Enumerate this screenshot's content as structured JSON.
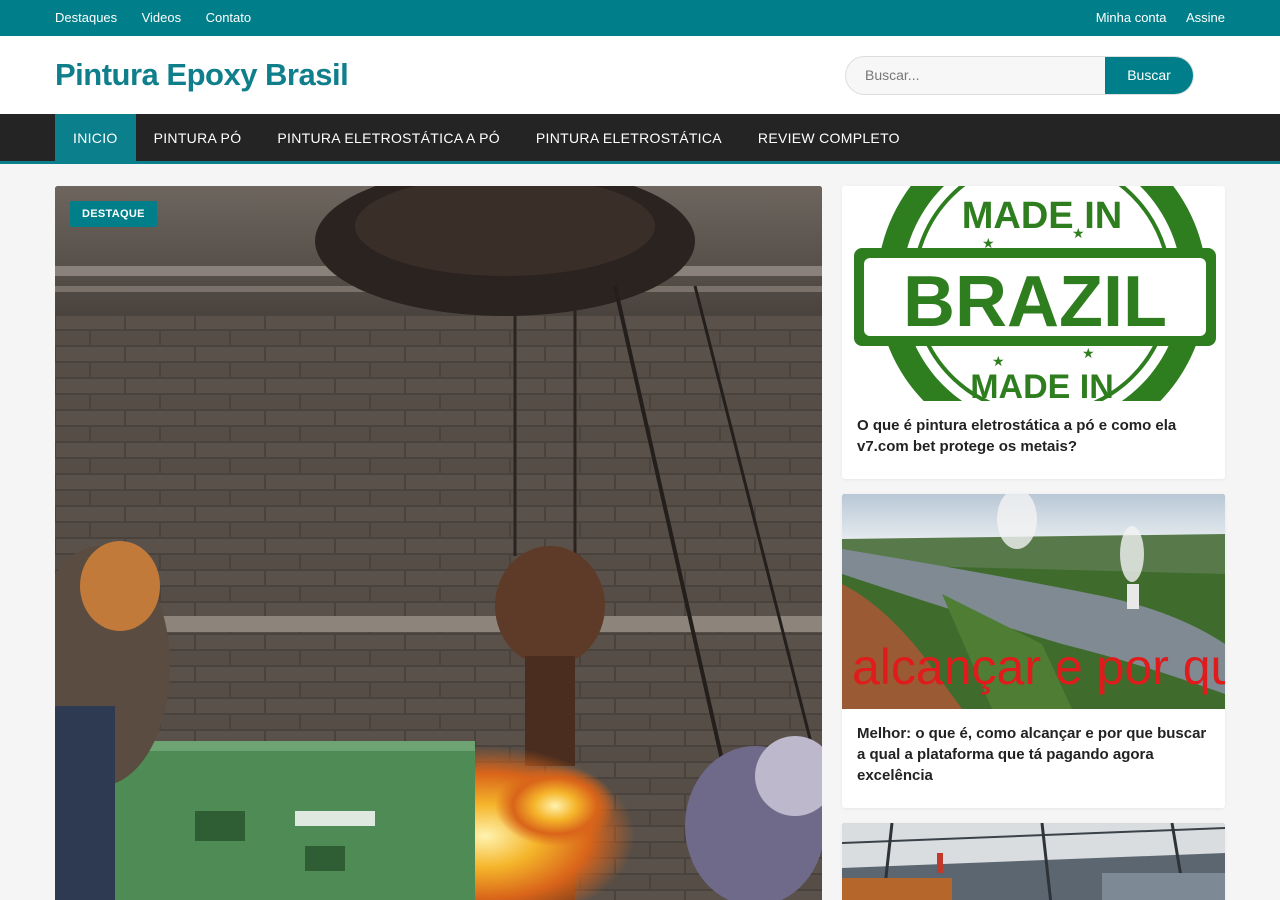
{
  "topbar": {
    "left_links": [
      "Destaques",
      "Videos",
      "Contato"
    ],
    "right_links": [
      "Minha conta",
      "Assine"
    ]
  },
  "header": {
    "logo": "Pintura Epoxy Brasil",
    "search_placeholder": "Buscar...",
    "search_button": "Buscar"
  },
  "nav": {
    "items": [
      "INICIO",
      "PINTURA PÓ",
      "PINTURA ELETROSTÁTICA A PÓ",
      "PINTURA ELETROSTÁTICA",
      "REVIEW COMPLETO"
    ]
  },
  "featured": {
    "badge": "DESTAQUE"
  },
  "sidebar": {
    "cards": [
      {
        "title": "O que é pintura eletrostática a pó e como ela v7.com bet protege os metais?",
        "image_text_top": "MADE IN",
        "image_text_main": "BRAZIL",
        "image_text_bottom": "MADE IN"
      },
      {
        "title": "Melhor: o que é, como alcançar e por que buscar a qual a plataforma que tá pagando agora excelência",
        "image_text": "alcançar e por qu"
      },
      {
        "title": ""
      }
    ]
  },
  "colors": {
    "teal": "#007f8a",
    "nav_dark": "#242424",
    "brazil_green": "#2e7d1f"
  }
}
